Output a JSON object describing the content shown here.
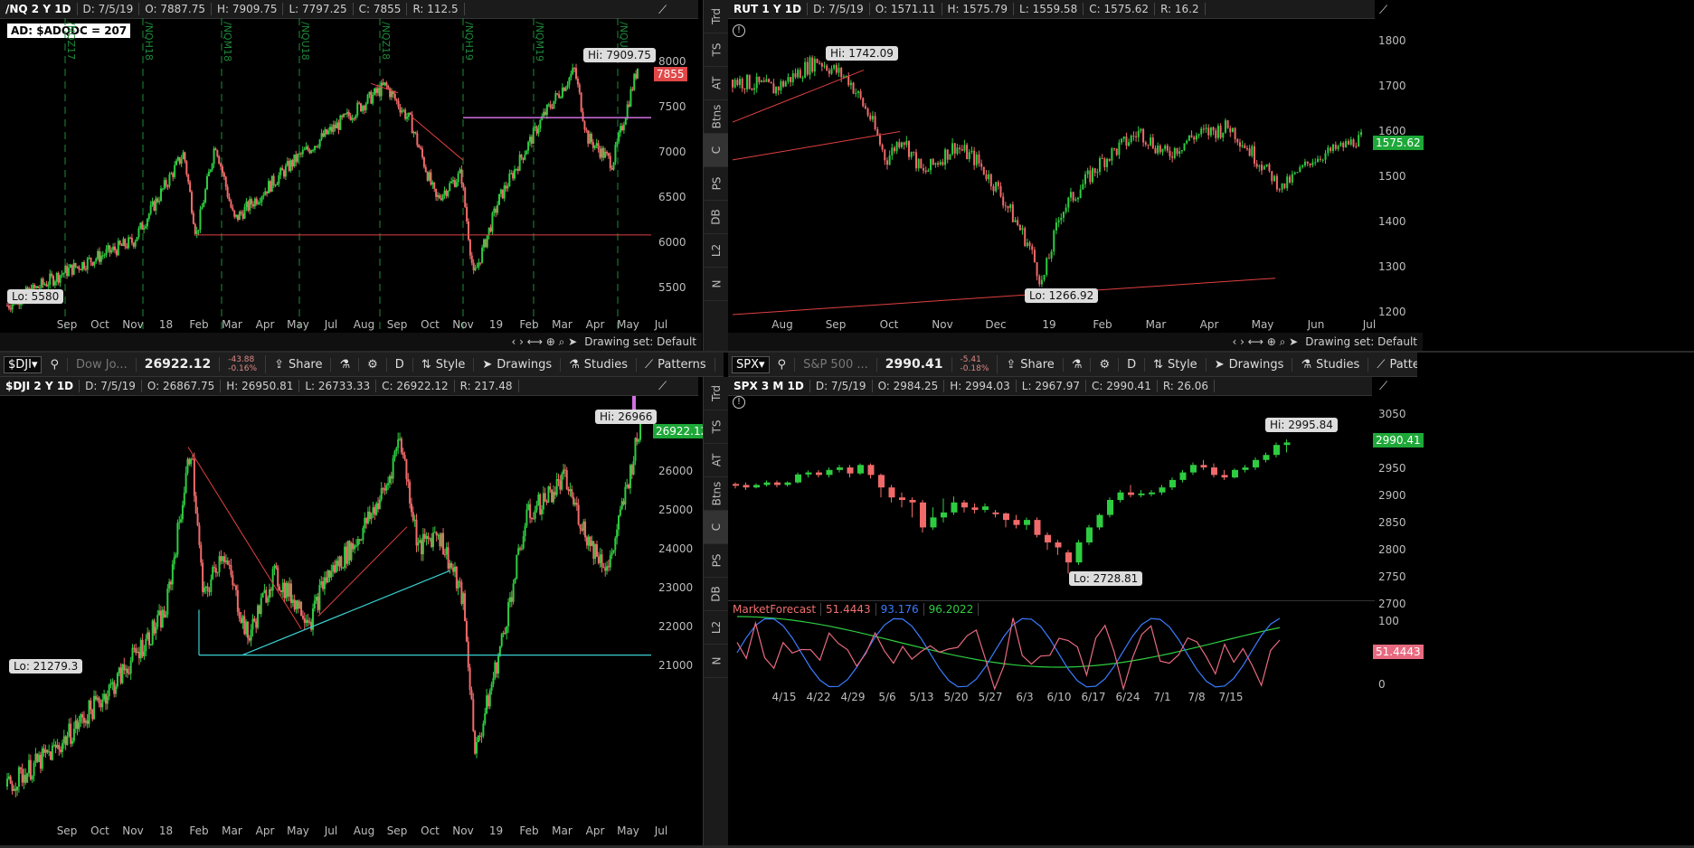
{
  "colors": {
    "up": "#2ecc40",
    "down": "#f06a6a",
    "bg": "#000000",
    "cyan": "#3ad0d0",
    "red_line": "#e04040",
    "violet": "#d070e0"
  },
  "nq": {
    "header": {
      "symbol": "/NQ 2 Y 1D",
      "date": "D: 7/5/19",
      "open": "O: 7887.75",
      "high": "H: 7909.75",
      "low": "L: 7797.25",
      "close": "C: 7855",
      "range": "R: 112.5"
    },
    "note": "AD: $ADQDC = 207",
    "hi": "Hi: 7909.75",
    "lo": "Lo: 5580",
    "last": "7855",
    "yticks": [
      "8000",
      "7500",
      "7000",
      "6500",
      "6000",
      "5500"
    ],
    "xticks": [
      "Sep",
      "Oct",
      "Nov",
      "18",
      "Feb",
      "Mar",
      "Apr",
      "May",
      "Jul",
      "Aug",
      "Sep",
      "Oct",
      "Nov",
      "19",
      "Feb",
      "Mar",
      "Apr",
      "May",
      "Jul"
    ],
    "rollovers": [
      "/NQZ17",
      "/NQH18",
      "/NQM18",
      "/NQU18",
      "/NQZ18",
      "/NQH19",
      "/NQM19",
      "/NQU19"
    ],
    "footer": "Drawing set: Default"
  },
  "rut": {
    "header": {
      "symbol": "RUT 1 Y 1D",
      "date": "D: 7/5/19",
      "open": "O: 1571.11",
      "high": "H: 1575.79",
      "low": "L: 1559.58",
      "close": "C: 1575.62",
      "range": "R: 16.2"
    },
    "hi": "Hi: 1742.09",
    "lo": "Lo: 1266.92",
    "last": "1575.62",
    "yticks": [
      "1800",
      "1700",
      "1600",
      "1500",
      "1400",
      "1300",
      "1200"
    ],
    "xticks": [
      "Aug",
      "Sep",
      "Oct",
      "Nov",
      "Dec",
      "19",
      "Feb",
      "Mar",
      "Apr",
      "May",
      "Jun",
      "Jul"
    ],
    "footer": "Drawing set: Default"
  },
  "side_tabs": [
    "Trd",
    "TS",
    "AT",
    "Btns",
    "C",
    "PS",
    "DB",
    "L2",
    "N"
  ],
  "dji": {
    "toolbar": {
      "symbol": "$DJI",
      "desc": "Dow Jo...",
      "price": "26922.12",
      "chg1": "-43.88",
      "chg2": "-0.16%",
      "share": "Share",
      "period": "D",
      "style": "Style",
      "drawings": "Drawings",
      "studies": "Studies",
      "patterns": "Patterns"
    },
    "header": {
      "symbol": "$DJI 2 Y 1D",
      "date": "D: 7/5/19",
      "open": "O: 26867.75",
      "high": "H: 26950.81",
      "low": "L: 26733.33",
      "close": "C: 26922.12",
      "range": "R: 217.48"
    },
    "hi": "Hi: 26966",
    "lo": "Lo: 21279.3",
    "last": "26922.12",
    "yticks": [
      "27000",
      "26000",
      "25000",
      "24000",
      "23000",
      "22000",
      "21000"
    ],
    "xticks": [
      "Sep",
      "Oct",
      "Nov",
      "18",
      "Feb",
      "Mar",
      "Apr",
      "May",
      "Jul",
      "Aug",
      "Sep",
      "Oct",
      "Nov",
      "19",
      "Feb",
      "Mar",
      "Apr",
      "May",
      "Jul"
    ]
  },
  "spx": {
    "toolbar": {
      "symbol": "SPX",
      "desc": "S&P 500 ...",
      "price": "2990.41",
      "chg1": "-5.41",
      "chg2": "-0.18%",
      "share": "Share",
      "period": "D",
      "style": "Style",
      "drawings": "Drawings",
      "studies": "Studies",
      "patterns": "Patterns"
    },
    "header": {
      "symbol": "SPX 3 M 1D",
      "date": "D: 7/5/19",
      "open": "O: 2984.25",
      "high": "H: 2994.03",
      "low": "L: 2967.97",
      "close": "C: 2990.41",
      "range": "R: 26.06"
    },
    "hi": "Hi: 2995.84",
    "lo": "Lo: 2728.81",
    "last": "2990.41",
    "yticks": [
      "3050",
      "3000",
      "2950",
      "2900",
      "2850",
      "2800",
      "2750",
      "2700"
    ],
    "xticks": [
      "4/15",
      "4/22",
      "4/29",
      "5/6",
      "5/13",
      "5/20",
      "5/27",
      "6/3",
      "6/10",
      "6/17",
      "6/24",
      "7/1",
      "7/8",
      "7/15"
    ],
    "study": {
      "name": "MarketForecast",
      "v1": "51.4443",
      "v2": "93.176",
      "v3": "96.2022",
      "last": "51.4443",
      "yticks": [
        "100",
        "50",
        "0"
      ]
    },
    "candles": [
      [
        2907,
        2905,
        2898,
        2910
      ],
      [
        2905,
        2900,
        2895,
        2910
      ],
      [
        2900,
        2905,
        2898,
        2908
      ],
      [
        2905,
        2910,
        2902,
        2914
      ],
      [
        2910,
        2905,
        2900,
        2914
      ],
      [
        2905,
        2910,
        2902,
        2912
      ],
      [
        2910,
        2926,
        2908,
        2930
      ],
      [
        2926,
        2930,
        2920,
        2934
      ],
      [
        2930,
        2925,
        2920,
        2935
      ],
      [
        2925,
        2935,
        2920,
        2940
      ],
      [
        2935,
        2940,
        2930,
        2945
      ],
      [
        2940,
        2928,
        2920,
        2945
      ],
      [
        2928,
        2945,
        2925,
        2948
      ],
      [
        2945,
        2925,
        2918,
        2948
      ],
      [
        2925,
        2900,
        2880,
        2928
      ],
      [
        2900,
        2880,
        2870,
        2905
      ],
      [
        2880,
        2875,
        2860,
        2890
      ],
      [
        2875,
        2870,
        2840,
        2880
      ],
      [
        2870,
        2820,
        2810,
        2875
      ],
      [
        2820,
        2840,
        2815,
        2860
      ],
      [
        2840,
        2850,
        2830,
        2878
      ],
      [
        2850,
        2870,
        2845,
        2882
      ],
      [
        2870,
        2860,
        2850,
        2875
      ],
      [
        2860,
        2855,
        2848,
        2868
      ],
      [
        2855,
        2862,
        2850,
        2868
      ],
      [
        2850,
        2848,
        2840,
        2855
      ],
      [
        2848,
        2835,
        2820,
        2850
      ],
      [
        2835,
        2825,
        2818,
        2845
      ],
      [
        2825,
        2835,
        2815,
        2840
      ],
      [
        2835,
        2805,
        2800,
        2840
      ],
      [
        2805,
        2790,
        2775,
        2810
      ],
      [
        2790,
        2780,
        2765,
        2795
      ],
      [
        2770,
        2750,
        2728,
        2775
      ],
      [
        2750,
        2790,
        2745,
        2795
      ],
      [
        2790,
        2820,
        2785,
        2825
      ],
      [
        2820,
        2845,
        2815,
        2848
      ],
      [
        2845,
        2875,
        2840,
        2880
      ],
      [
        2875,
        2890,
        2870,
        2895
      ],
      [
        2890,
        2885,
        2880,
        2905
      ],
      [
        2885,
        2888,
        2880,
        2895
      ],
      [
        2888,
        2890,
        2882,
        2895
      ],
      [
        2890,
        2900,
        2885,
        2905
      ],
      [
        2900,
        2915,
        2895,
        2920
      ],
      [
        2915,
        2930,
        2910,
        2935
      ],
      [
        2930,
        2945,
        2925,
        2950
      ],
      [
        2945,
        2940,
        2935,
        2955
      ],
      [
        2940,
        2925,
        2920,
        2948
      ],
      [
        2925,
        2920,
        2915,
        2935
      ],
      [
        2920,
        2935,
        2918,
        2938
      ],
      [
        2935,
        2940,
        2930,
        2945
      ],
      [
        2940,
        2955,
        2935,
        2960
      ],
      [
        2955,
        2965,
        2950,
        2970
      ],
      [
        2965,
        2985,
        2960,
        2990
      ],
      [
        2985,
        2990,
        2970,
        2996
      ]
    ]
  }
}
